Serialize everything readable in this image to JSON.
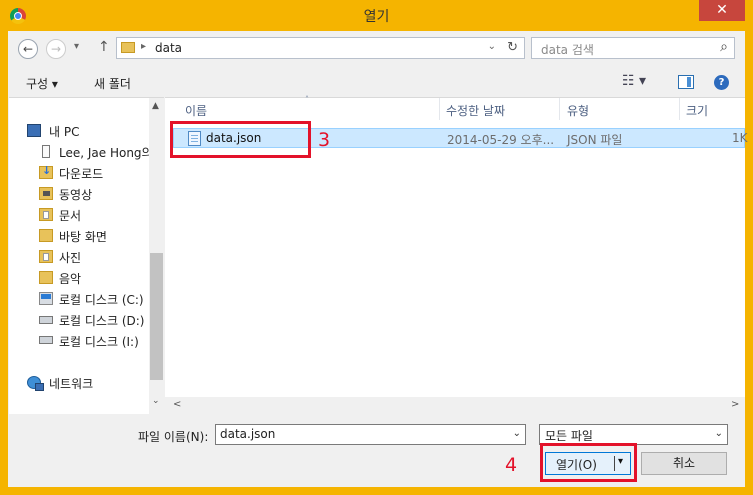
{
  "window": {
    "title": "열기",
    "close_label": "✕"
  },
  "address_bar": {
    "back_glyph": "←",
    "forward_glyph": "→",
    "recent_glyph": "▾",
    "up_glyph": "↑",
    "separator_glyph": "▸",
    "path": "data",
    "dropdown_glyph": "⌄",
    "refresh_glyph": "↻"
  },
  "search": {
    "placeholder": "data 검색",
    "icon_glyph": "⌕"
  },
  "toolbar": {
    "organize_label": "구성 ▾",
    "new_folder_label": "새 폴더",
    "view_glyph": "☷ ▾",
    "help_label": "?"
  },
  "navigation": {
    "items": [
      {
        "label": "내 PC",
        "icon": "computer-icon"
      },
      {
        "label": "Lee, Jae Hong의",
        "icon": "user-folder-icon"
      },
      {
        "label": "다운로드",
        "icon": "downloads-folder-icon"
      },
      {
        "label": "동영상",
        "icon": "videos-folder-icon"
      },
      {
        "label": "문서",
        "icon": "documents-folder-icon"
      },
      {
        "label": "바탕 화면",
        "icon": "desktop-folder-icon"
      },
      {
        "label": "사진",
        "icon": "pictures-folder-icon"
      },
      {
        "label": "음악",
        "icon": "music-folder-icon"
      },
      {
        "label": "로컬 디스크 (C:)",
        "icon": "system-drive-icon"
      },
      {
        "label": "로컬 디스크 (D:)",
        "icon": "drive-icon"
      },
      {
        "label": "로컬 디스크 (I:)",
        "icon": "usb-drive-icon"
      },
      {
        "label": "네트워크",
        "icon": "network-icon"
      }
    ],
    "scroll_up_glyph": "▲",
    "scroll_down_glyph": "⌄"
  },
  "file_list": {
    "columns": [
      "이름",
      "수정한 날짜",
      "유형",
      "크기"
    ],
    "sort_glyph": "˄",
    "rows": [
      {
        "name": "data.json",
        "modified": "2014-05-29 오후...",
        "type": "JSON 파일",
        "size": "1K"
      }
    ],
    "scroll_left_glyph": "<",
    "scroll_right_glyph": ">"
  },
  "footer": {
    "filename_label": "파일 이름(N):",
    "filename_value": "data.json",
    "filename_dropdown_glyph": "⌄",
    "filetype_value": "모든 파일",
    "filetype_dropdown_glyph": "⌄",
    "open_label": "열기(O)",
    "open_dropdown_glyph": "▾",
    "cancel_label": "취소"
  },
  "annotations": {
    "file_step": "3",
    "open_step": "4",
    "color": "#e3122a"
  },
  "colors": {
    "frame": "#f5b400",
    "selection": "#cce8ff",
    "close_button": "#c7463d"
  }
}
